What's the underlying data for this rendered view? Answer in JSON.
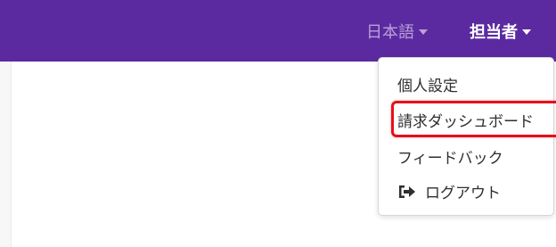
{
  "navbar": {
    "language_label": "日本語",
    "user_label": "担当者",
    "background": "#5b2aa0"
  },
  "user_menu": {
    "items": [
      {
        "label": "個人設定",
        "icon": ""
      },
      {
        "label": "請求ダッシュボード",
        "icon": "",
        "highlighted": true
      },
      {
        "label": "フィードバック",
        "icon": ""
      },
      {
        "label": "ログアウト",
        "icon": "sign-out-icon"
      }
    ],
    "highlight_color": "#e3111a"
  }
}
